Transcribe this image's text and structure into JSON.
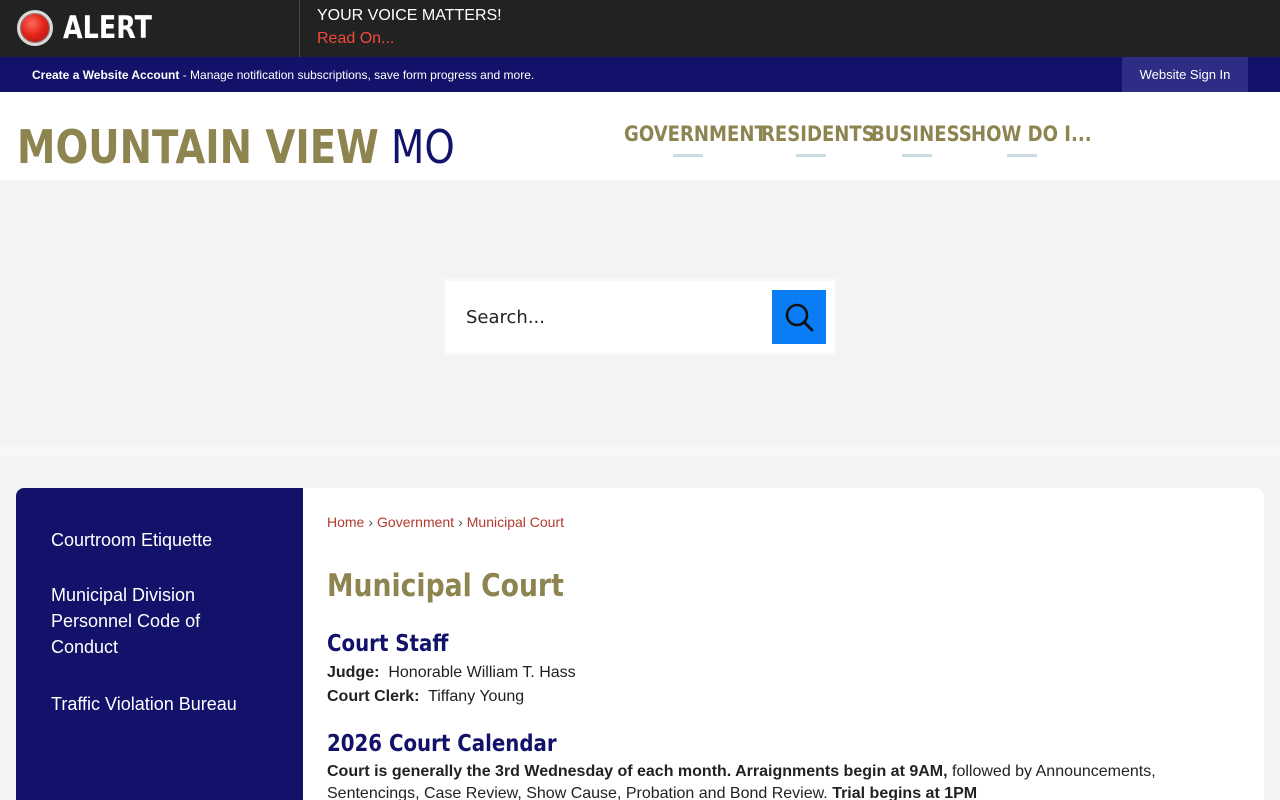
{
  "alert": {
    "label": "ALERT",
    "message": "YOUR VOICE MATTERS!",
    "link": "Read On..."
  },
  "account_bar": {
    "create_label": "Create a Website Account",
    "description": " - Manage notification subscriptions, save form progress and more.",
    "signin_label": "Website Sign In"
  },
  "header": {
    "logo_main": "MOUNTAIN VIEW",
    "logo_sub": "MO",
    "nav": [
      {
        "label": "GOVERNMENT"
      },
      {
        "label": "RESIDENTS"
      },
      {
        "label": "BUSINESS"
      },
      {
        "label": "HOW DO I..."
      }
    ]
  },
  "search": {
    "placeholder": "Search..."
  },
  "sidebar": {
    "items": [
      {
        "label": "Courtroom Etiquette"
      },
      {
        "label": "Municipal Division Personnel Code of Conduct"
      },
      {
        "label": "Traffic Violation Bureau"
      }
    ]
  },
  "breadcrumb": {
    "items": [
      "Home",
      "Government",
      "Municipal Court"
    ],
    "separator": "›"
  },
  "content": {
    "title": "Municipal Court",
    "staff": {
      "heading": "Court Staff",
      "judge_label": "Judge:",
      "judge_value": "Honorable William T. Hass",
      "clerk_label": "Court Clerk:",
      "clerk_value": "Tiffany Young"
    },
    "calendar": {
      "heading": "2026 Court Calendar",
      "bold_1": "Court is generally the 3rd Wednesday of each month.  Arraignments begin at 9AM,",
      "text_1": " followed by Announcements, Sentencings, Case Review, Show Cause, Probation and Bond Review.  ",
      "bold_2": "Trial begins at 1PM"
    }
  },
  "colors": {
    "navy": "#12126a",
    "gold": "#8d8450",
    "alert_red": "#ef4a3a",
    "search_blue": "#0a7cf5"
  }
}
